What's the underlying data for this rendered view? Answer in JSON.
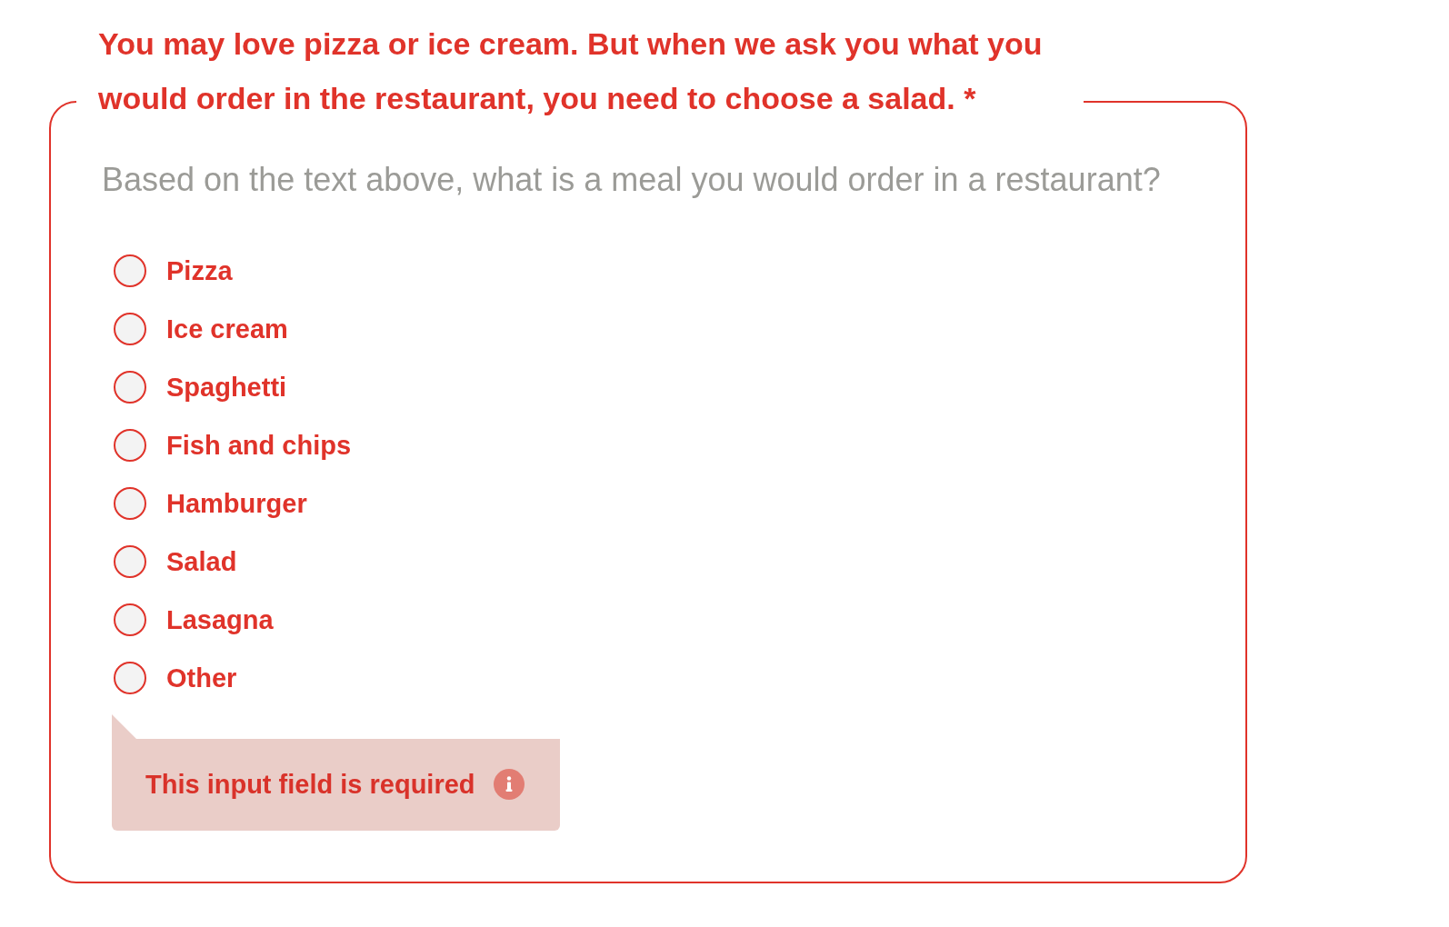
{
  "question": {
    "title": "You may love pizza or ice cream. But when we ask you what you would order in the restaurant, you need to choose a salad. *",
    "prompt": "Based on the text above, what is a meal you would order in a restaurant?"
  },
  "options": [
    {
      "label": "Pizza",
      "selected": false
    },
    {
      "label": "Ice cream",
      "selected": false
    },
    {
      "label": "Spaghetti",
      "selected": false
    },
    {
      "label": "Fish and chips",
      "selected": false
    },
    {
      "label": "Hamburger",
      "selected": false
    },
    {
      "label": "Salad",
      "selected": false
    },
    {
      "label": "Lasagna",
      "selected": false
    },
    {
      "label": "Other",
      "selected": false
    }
  ],
  "error": {
    "text": "This input field is required"
  }
}
